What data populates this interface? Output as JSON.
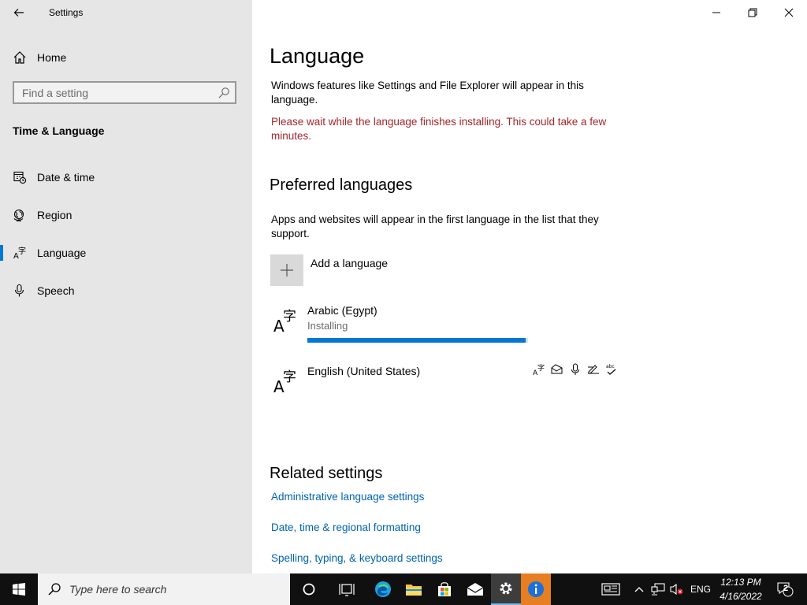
{
  "window": {
    "title": "Settings"
  },
  "sidebar": {
    "home_label": "Home",
    "search_placeholder": "Find a setting",
    "section_title": "Time & Language",
    "items": [
      {
        "label": "Date & time",
        "icon": "date-time-icon"
      },
      {
        "label": "Region",
        "icon": "globe-icon"
      },
      {
        "label": "Language",
        "icon": "language-icon",
        "active": true
      },
      {
        "label": "Speech",
        "icon": "microphone-icon"
      }
    ]
  },
  "main": {
    "title": "Language",
    "description": "Windows features like Settings and File Explorer will appear in this language.",
    "warning": "Please wait while the language finishes installing. This could take a few minutes.",
    "preferred_heading": "Preferred languages",
    "preferred_description": "Apps and websites will appear in the first language in the list that they support.",
    "add_language_label": "Add a language",
    "languages": [
      {
        "name": "Arabic (Egypt)",
        "status": "Installing",
        "progress": 0.99
      },
      {
        "name": "English (United States)",
        "features": [
          "display-language-icon",
          "text-to-speech-icon",
          "speech-icon",
          "handwriting-icon",
          "spellcheck-icon"
        ]
      }
    ],
    "related_heading": "Related settings",
    "related_links": [
      "Administrative language settings",
      "Date, time & regional formatting",
      "Spelling, typing, & keyboard settings"
    ]
  },
  "taskbar": {
    "search_placeholder": "Type here to search",
    "language_indicator": "ENG",
    "time": "12:13 PM",
    "date": "4/16/2022",
    "notification_count": "2"
  },
  "colors": {
    "accent": "#0078d4",
    "warning": "#a4262c",
    "link": "#0063b1"
  }
}
